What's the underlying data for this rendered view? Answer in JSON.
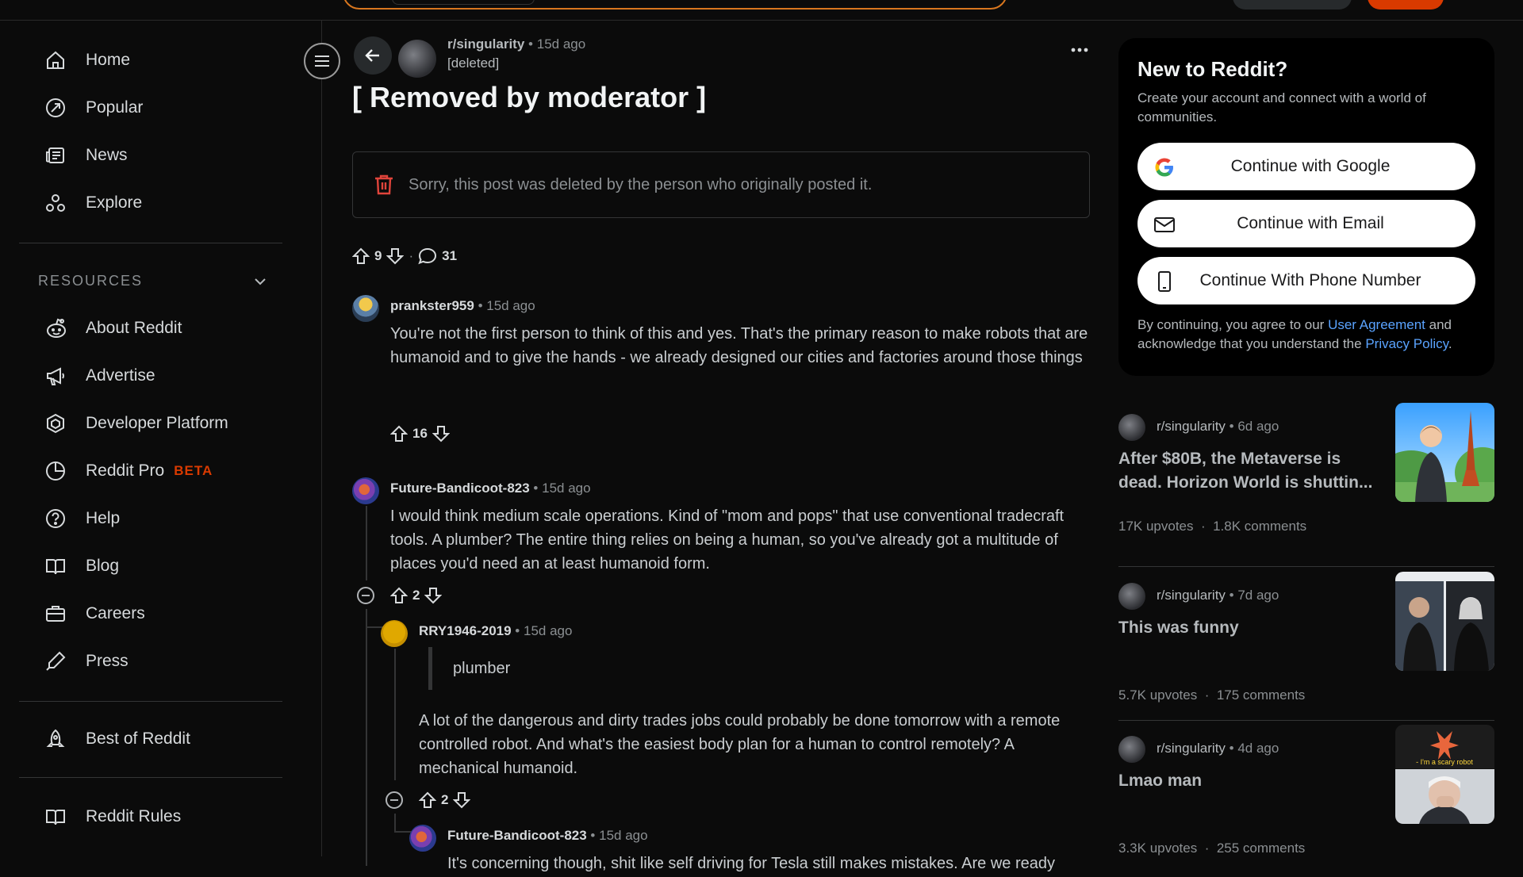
{
  "sidebar": {
    "items": [
      {
        "label": "Home",
        "icon": "home-icon"
      },
      {
        "label": "Popular",
        "icon": "popular-icon"
      },
      {
        "label": "News",
        "icon": "news-icon"
      },
      {
        "label": "Explore",
        "icon": "explore-icon"
      }
    ],
    "resources_heading": "RESOURCES",
    "resources": [
      {
        "label": "About Reddit",
        "icon": "reddit-alien-icon"
      },
      {
        "label": "Advertise",
        "icon": "megaphone-icon"
      },
      {
        "label": "Developer Platform",
        "icon": "developer-icon"
      },
      {
        "label": "Reddit Pro",
        "icon": "pie-chart-icon",
        "badge": "BETA"
      },
      {
        "label": "Help",
        "icon": "help-icon"
      },
      {
        "label": "Blog",
        "icon": "book-icon"
      },
      {
        "label": "Careers",
        "icon": "briefcase-icon"
      },
      {
        "label": "Press",
        "icon": "pen-icon"
      }
    ],
    "best_of": "Best of Reddit",
    "rules": "Reddit Rules"
  },
  "post": {
    "subreddit": "r/singularity",
    "time": "15d ago",
    "author": "[deleted]",
    "title": "[ Removed by moderator ]",
    "deleted_notice": "Sorry, this post was deleted by the person who originally posted it.",
    "upvotes": "9",
    "comments": "31"
  },
  "comments": [
    {
      "user": "prankster959",
      "time": "15d ago",
      "body": "You're not the first person to think of this and yes. That's the primary reason to make robots that are humanoid and to give the hands - we already designed our cities and factories around those things",
      "score": "16"
    },
    {
      "user": "Future-Bandicoot-823",
      "time": "15d ago",
      "body": "I would think medium scale operations. Kind of \"mom and pops\" that use conventional tradecraft tools. A plumber? The entire thing relies on being a human, so you've already got a multitude of places you'd need an at least humanoid form.",
      "score": "2"
    },
    {
      "user": "RRY1946-2019",
      "time": "15d ago",
      "quote": "plumber",
      "body": "A lot of the dangerous and dirty trades jobs could probably be done tomorrow with a remote controlled robot. And what's the easiest body plan for a human to control remotely? A mechanical humanoid.",
      "score": "2"
    },
    {
      "user": "Future-Bandicoot-823",
      "time": "15d ago",
      "body": "It's concerning though, shit like self driving for Tesla still makes mistakes. Are we ready"
    }
  ],
  "signup": {
    "title": "New to Reddit?",
    "desc": "Create your account and connect with a world of communities.",
    "google": "Continue with Google",
    "email": "Continue with Email",
    "phone": "Continue With Phone Number",
    "legal_prefix": "By continuing, you agree to our",
    "user_agreement": "User Agreement",
    "legal_mid": "and acknowledge that you understand the",
    "privacy": "Privacy Policy",
    "legal_suffix": "."
  },
  "recommended": [
    {
      "sub": "r/singularity",
      "time": "6d ago",
      "title": "After $80B, the Metaverse is dead. Horizon World is shuttin...",
      "upvotes": "17K upvotes",
      "comments": "1.8K comments"
    },
    {
      "sub": "r/singularity",
      "time": "7d ago",
      "title": "This was funny",
      "upvotes": "5.7K upvotes",
      "comments": "175 comments"
    },
    {
      "sub": "r/singularity",
      "time": "4d ago",
      "title": "Lmao man",
      "upvotes": "3.3K upvotes",
      "comments": "255 comments",
      "thumb_caption": "- I'm a scary robot"
    }
  ],
  "colors": {
    "accent": "#d93a00",
    "link": "#5aa3ff",
    "background": "#0b0b0b"
  }
}
